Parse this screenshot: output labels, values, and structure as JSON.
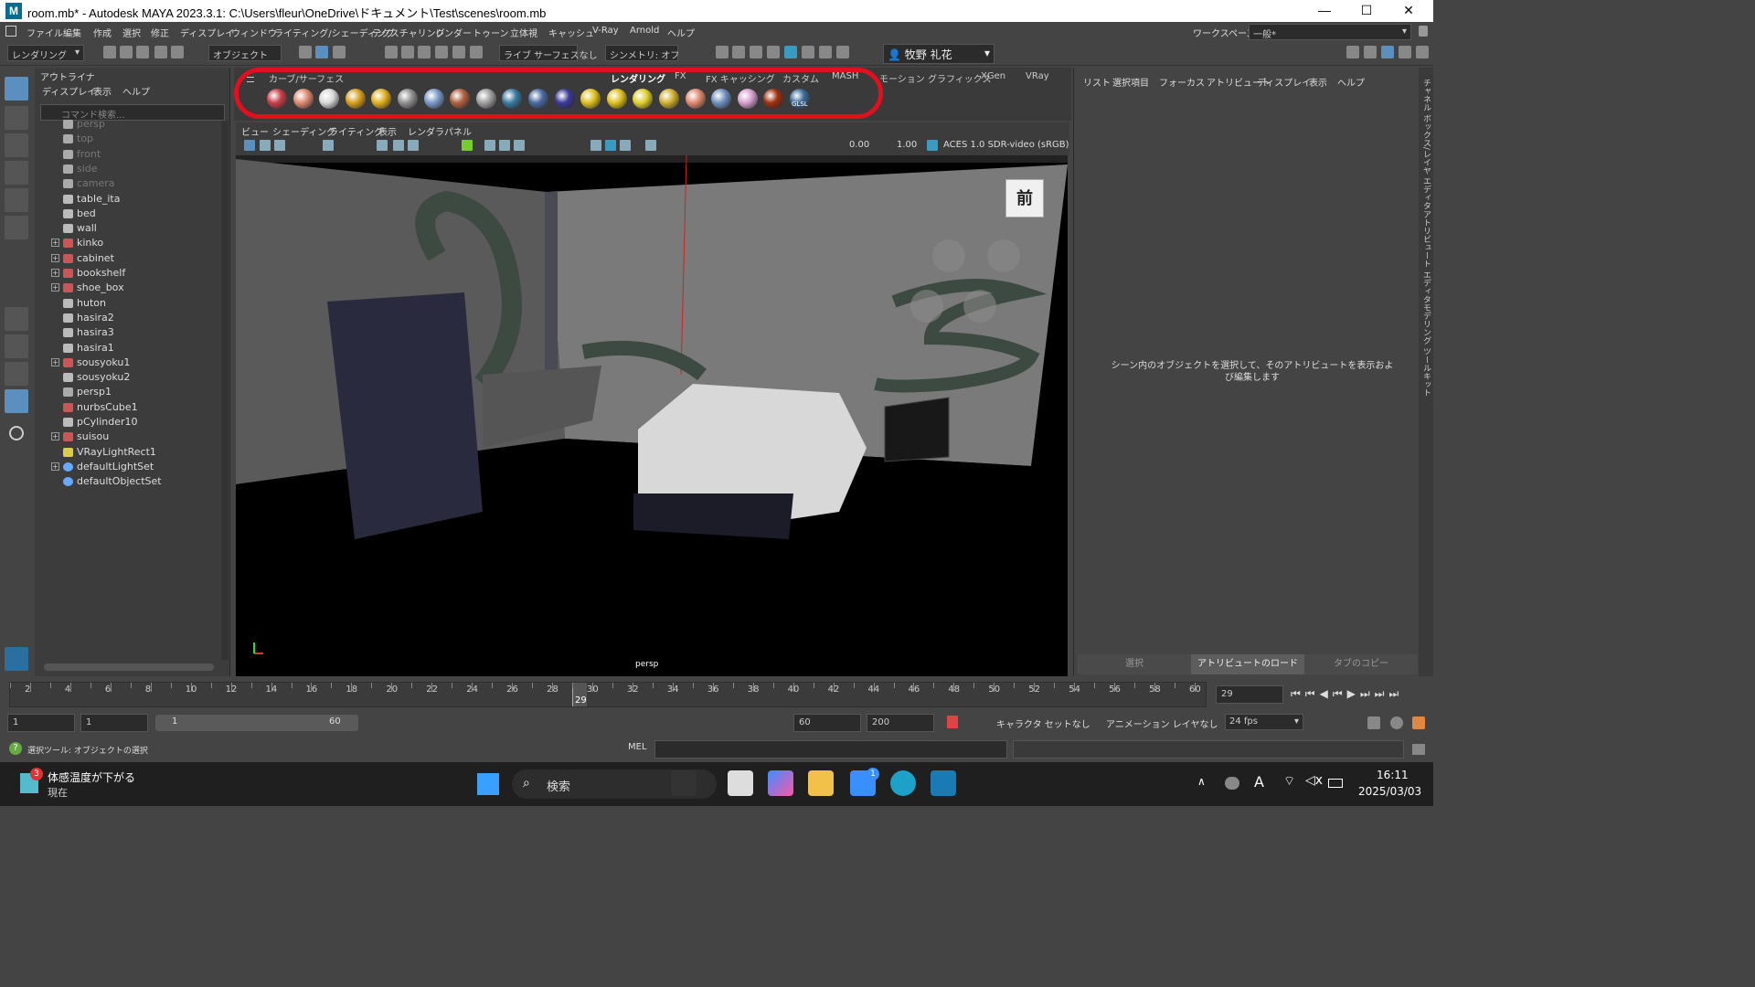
{
  "window": {
    "title": "room.mb* - Autodesk MAYA 2023.3.1: C:\\Users\\fleur\\OneDrive\\ドキュメント\\Test\\scenes\\room.mb",
    "logo": "M",
    "minimize": "—",
    "maximize": "☐",
    "close": "✕"
  },
  "menu": {
    "items": [
      "ファイル",
      "編集",
      "作成",
      "選択",
      "修正",
      "ディスプレイ",
      "ウィンドウ",
      "ライティング/シェーディング",
      "テクスチャリング",
      "レンダー",
      "トゥーン",
      "立体視",
      "キャッシュ",
      "V-Ray",
      "Arnold",
      "ヘルプ"
    ],
    "workspace_label": "ワークスペース:",
    "workspace_value": "一般*"
  },
  "toolbar": {
    "mode": "レンダリング",
    "object_mode": "オブジェクト",
    "live_surface": "ライブ サーフェスなし",
    "symmetry": "シンメトリ: オフ",
    "user": "牧野 礼花"
  },
  "outliner": {
    "title": "アウトライナ",
    "menu": [
      "ディスプレイ",
      "表示",
      "ヘルプ"
    ],
    "search_placeholder": "コマンド検索...",
    "items": [
      {
        "label": "persp",
        "type": "camera",
        "dim": true,
        "expand": false
      },
      {
        "label": "top",
        "type": "camera",
        "dim": true,
        "expand": false
      },
      {
        "label": "front",
        "type": "camera",
        "dim": true,
        "expand": false
      },
      {
        "label": "side",
        "type": "camera",
        "dim": true,
        "expand": false
      },
      {
        "label": "camera",
        "type": "camera",
        "dim": true,
        "expand": false
      },
      {
        "label": "table_ita",
        "type": "mesh",
        "dim": false,
        "expand": false
      },
      {
        "label": "bed",
        "type": "mesh",
        "dim": false,
        "expand": false
      },
      {
        "label": "wall",
        "type": "mesh",
        "dim": false,
        "expand": false
      },
      {
        "label": "kinko",
        "type": "group",
        "dim": false,
        "expand": true
      },
      {
        "label": "cabinet",
        "type": "group",
        "dim": false,
        "expand": true
      },
      {
        "label": "bookshelf",
        "type": "group",
        "dim": false,
        "expand": true
      },
      {
        "label": "shoe_box",
        "type": "group",
        "dim": false,
        "expand": true
      },
      {
        "label": "huton",
        "type": "mesh",
        "dim": false,
        "expand": false
      },
      {
        "label": "hasira2",
        "type": "mesh",
        "dim": false,
        "expand": false
      },
      {
        "label": "hasira3",
        "type": "mesh",
        "dim": false,
        "expand": false
      },
      {
        "label": "hasira1",
        "type": "mesh",
        "dim": false,
        "expand": false
      },
      {
        "label": "sousyoku1",
        "type": "group",
        "dim": false,
        "expand": true
      },
      {
        "label": "sousyoku2",
        "type": "mesh",
        "dim": false,
        "expand": false
      },
      {
        "label": "persp1",
        "type": "camera",
        "dim": false,
        "expand": false
      },
      {
        "label": "nurbsCube1",
        "type": "group",
        "dim": false,
        "expand": false
      },
      {
        "label": "pCylinder10",
        "type": "mesh",
        "dim": false,
        "expand": false
      },
      {
        "label": "suisou",
        "type": "group",
        "dim": false,
        "expand": true
      },
      {
        "label": "VRayLightRect1",
        "type": "light",
        "dim": false,
        "expand": false
      },
      {
        "label": "defaultLightSet",
        "type": "set",
        "dim": false,
        "expand": true
      },
      {
        "label": "defaultObjectSet",
        "type": "set",
        "dim": false,
        "expand": false
      }
    ]
  },
  "shelf": {
    "tabs": [
      "カーブ/サーフェス",
      "",
      "",
      "",
      "レンダリング",
      "FX",
      "FX キャッシング",
      "カスタム",
      "MASH",
      "モーション グラフィックス",
      "XGen",
      "VRay"
    ],
    "ball_colors": [
      "#c8404a",
      "#e08a70",
      "#d8d8d8",
      "#d8a020",
      "#e0b020",
      "#909090",
      "#7a9ac8",
      "#b06040",
      "#a0a0a0",
      "#3a7aa0",
      "#4a6aa0",
      "#3a3a9a",
      "#e0c020",
      "#e0c020",
      "#e0d030",
      "#d0b030",
      "#e08a70",
      "#7090c0",
      "#d8a0d0",
      "#a03010",
      "#3a6a9a"
    ],
    "glsl_label": "GLSL"
  },
  "viewport": {
    "menu": [
      "ビュー",
      "シェーディング",
      "ライティング",
      "表示",
      "レンダラ",
      "パネル"
    ],
    "field_a": "0.00",
    "field_b": "1.00",
    "colorspace": "ACES 1.0 SDR-video (sRGB)",
    "camera_label": "persp",
    "viewcube_label": "前"
  },
  "attribute_editor": {
    "menu": [
      "リスト",
      "選択項目",
      "フォーカス",
      "アトリビュート",
      "ディスプレイ",
      "表示",
      "ヘルプ"
    ],
    "message": "シーン内のオブジェクトを選択して、そのアトリビュートを表示および編集します",
    "buttons": [
      "選択",
      "アトリビュートのロード",
      "タブのコピー"
    ]
  },
  "side_tabs": [
    "チャネル ボックス/レイヤ エディタ",
    "アトリビュート エディタ",
    "モデリング ツールキット"
  ],
  "timeline": {
    "labels": [
      "2",
      "4",
      "6",
      "8",
      "10",
      "12",
      "14",
      "16",
      "18",
      "20",
      "22",
      "24",
      "26",
      "28",
      "30",
      "32",
      "34",
      "36",
      "38",
      "40",
      "42",
      "44",
      "46",
      "48",
      "50",
      "52",
      "54",
      "56",
      "58",
      "60"
    ],
    "current_frame": "29",
    "current_frame_field": "29",
    "playhead_frame": 29
  },
  "range": {
    "start": "1",
    "start2": "1",
    "slider_start": "1",
    "slider_end": "60",
    "end": "60",
    "end2": "200",
    "character_set": "キャラクタ セットなし",
    "anim_layer": "アニメーション レイヤなし",
    "fps": "24 fps"
  },
  "command": {
    "status": "選択ツール: オブジェクトの選択",
    "language": "MEL"
  },
  "taskbar": {
    "weather_badge": "3",
    "weather_title": "体感温度が下がる",
    "weather_sub": "現在",
    "search_placeholder": "検索",
    "store_badge": "1",
    "time": "16:11",
    "date": "2025/03/03"
  }
}
